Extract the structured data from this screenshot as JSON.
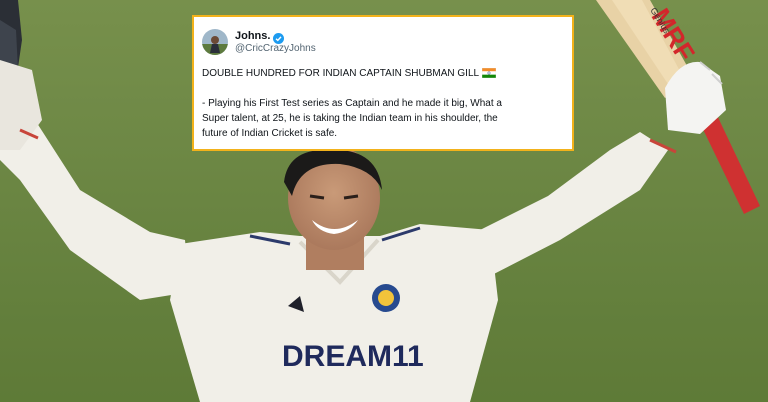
{
  "tweet": {
    "display_name": "Johns.",
    "verified_icon": "verified-badge-icon",
    "handle": "@CricCrazyJohns",
    "headline": "DOUBLE HUNDRED FOR INDIAN CAPTAIN SHUBMAN GILL",
    "headline_icon": "india-flag-icon",
    "body_line_1": "- Playing his First Test series as Captain and he made it big, What a",
    "body_line_2": "Super talent, at 25, he is taking the Indian team in his shoulder, the",
    "body_line_3": "future of Indian Cricket is safe."
  },
  "photo": {
    "jersey_sponsor": "DREAM11",
    "bat_brand": "MRF",
    "bat_label": "Genius"
  },
  "colors": {
    "card_border": "#f2b21b",
    "verified": "#1d9bf0",
    "grass": "#6f8a45",
    "jersey": "#f1efe8",
    "sponsor_text": "#1f2a5c"
  }
}
